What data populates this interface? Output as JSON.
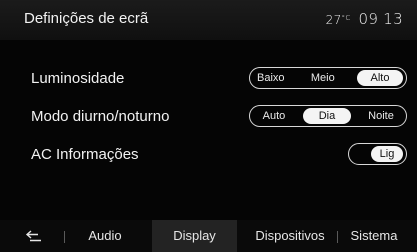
{
  "header": {
    "title": "Definições de ecrã",
    "temperature": "27",
    "temperature_unit": "°C",
    "time": "09 13"
  },
  "settings": [
    {
      "label": "Luminosidade",
      "options": [
        "Baixo",
        "Meio",
        "Alto"
      ],
      "selected": "Alto"
    },
    {
      "label": "Modo diurno/noturno",
      "options": [
        "Auto",
        "Dia",
        "Noite"
      ],
      "selected": "Dia"
    },
    {
      "label": "AC Informações",
      "toggle": "Lig"
    }
  ],
  "tabs": {
    "back_icon": "back-arrow-icon",
    "items": [
      "Audio",
      "Display",
      "Dispositivos",
      "Sistema"
    ],
    "active": "Display"
  },
  "colors": {
    "background": "#050505",
    "selected_option_bg": "#f4f4f4",
    "active_tab_bg": "#232323"
  }
}
